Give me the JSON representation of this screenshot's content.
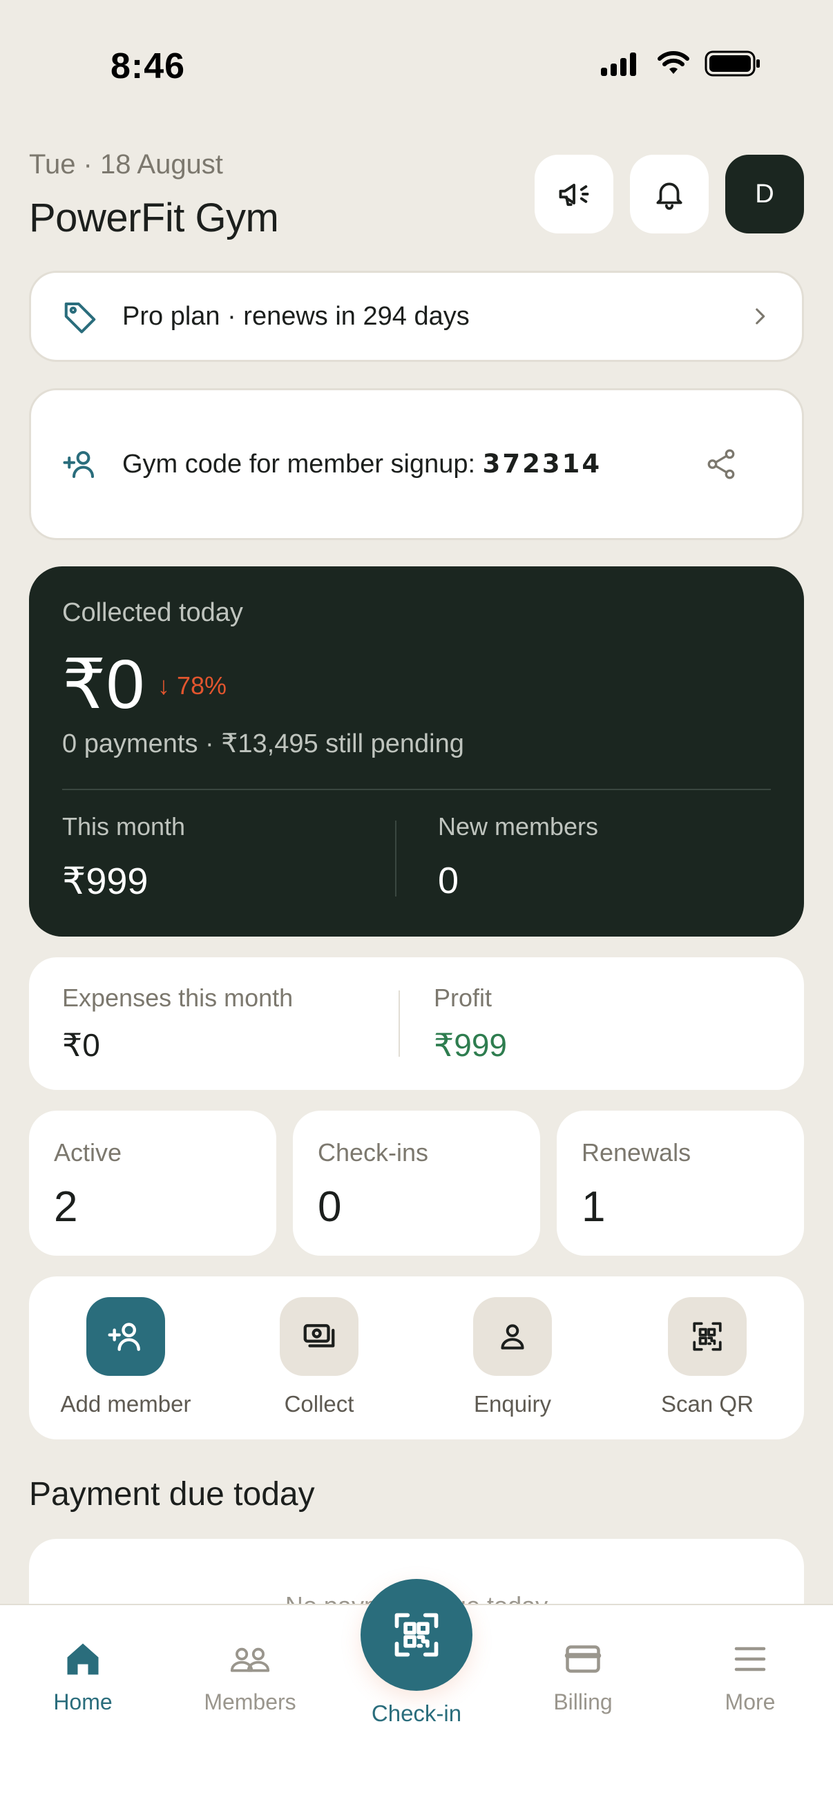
{
  "status_bar": {
    "time": "8:46"
  },
  "header": {
    "date": "Tue · 18 August",
    "gym_name": "PowerFit Gym",
    "avatar_initial": "D",
    "icons": [
      "megaphone-icon",
      "bell-icon"
    ]
  },
  "plan": {
    "label": "Pro plan · renews in 294 days"
  },
  "gym_code": {
    "label": "Gym code for member signup: ",
    "code": "372314"
  },
  "collected": {
    "label": "Collected today",
    "amount": "₹0",
    "delta": "↓ 78%",
    "sub": "0 payments · ₹13,495 still pending",
    "this_month_label": "This month",
    "this_month_value": "₹999",
    "new_members_label": "New members",
    "new_members_value": "0"
  },
  "finance": {
    "expenses_label": "Expenses this month",
    "expenses_value": "₹0",
    "profit_label": "Profit",
    "profit_value": "₹999"
  },
  "stats": [
    {
      "label": "Active",
      "value": "2"
    },
    {
      "label": "Check-ins",
      "value": "0"
    },
    {
      "label": "Renewals",
      "value": "1"
    }
  ],
  "actions": [
    {
      "label": "Add member",
      "icon": "add-person-icon"
    },
    {
      "label": "Collect",
      "icon": "cash-icon"
    },
    {
      "label": "Enquiry",
      "icon": "person-icon"
    },
    {
      "label": "Scan QR",
      "icon": "qr-icon"
    }
  ],
  "payment_due": {
    "title": "Payment due today",
    "empty_text": "No payments due today"
  },
  "nav": [
    {
      "label": "Home",
      "icon": "home-icon"
    },
    {
      "label": "Members",
      "icon": "members-icon"
    },
    {
      "label": "Check-in",
      "icon": "qr-scan-icon"
    },
    {
      "label": "Billing",
      "icon": "card-icon"
    },
    {
      "label": "More",
      "icon": "menu-icon"
    }
  ],
  "colors": {
    "background": "#EEEBE4",
    "dark_card": "#1B2620",
    "accent_teal": "#2A6D7C",
    "profit_green": "#2E7D4F",
    "delta_red": "#E2552E"
  }
}
